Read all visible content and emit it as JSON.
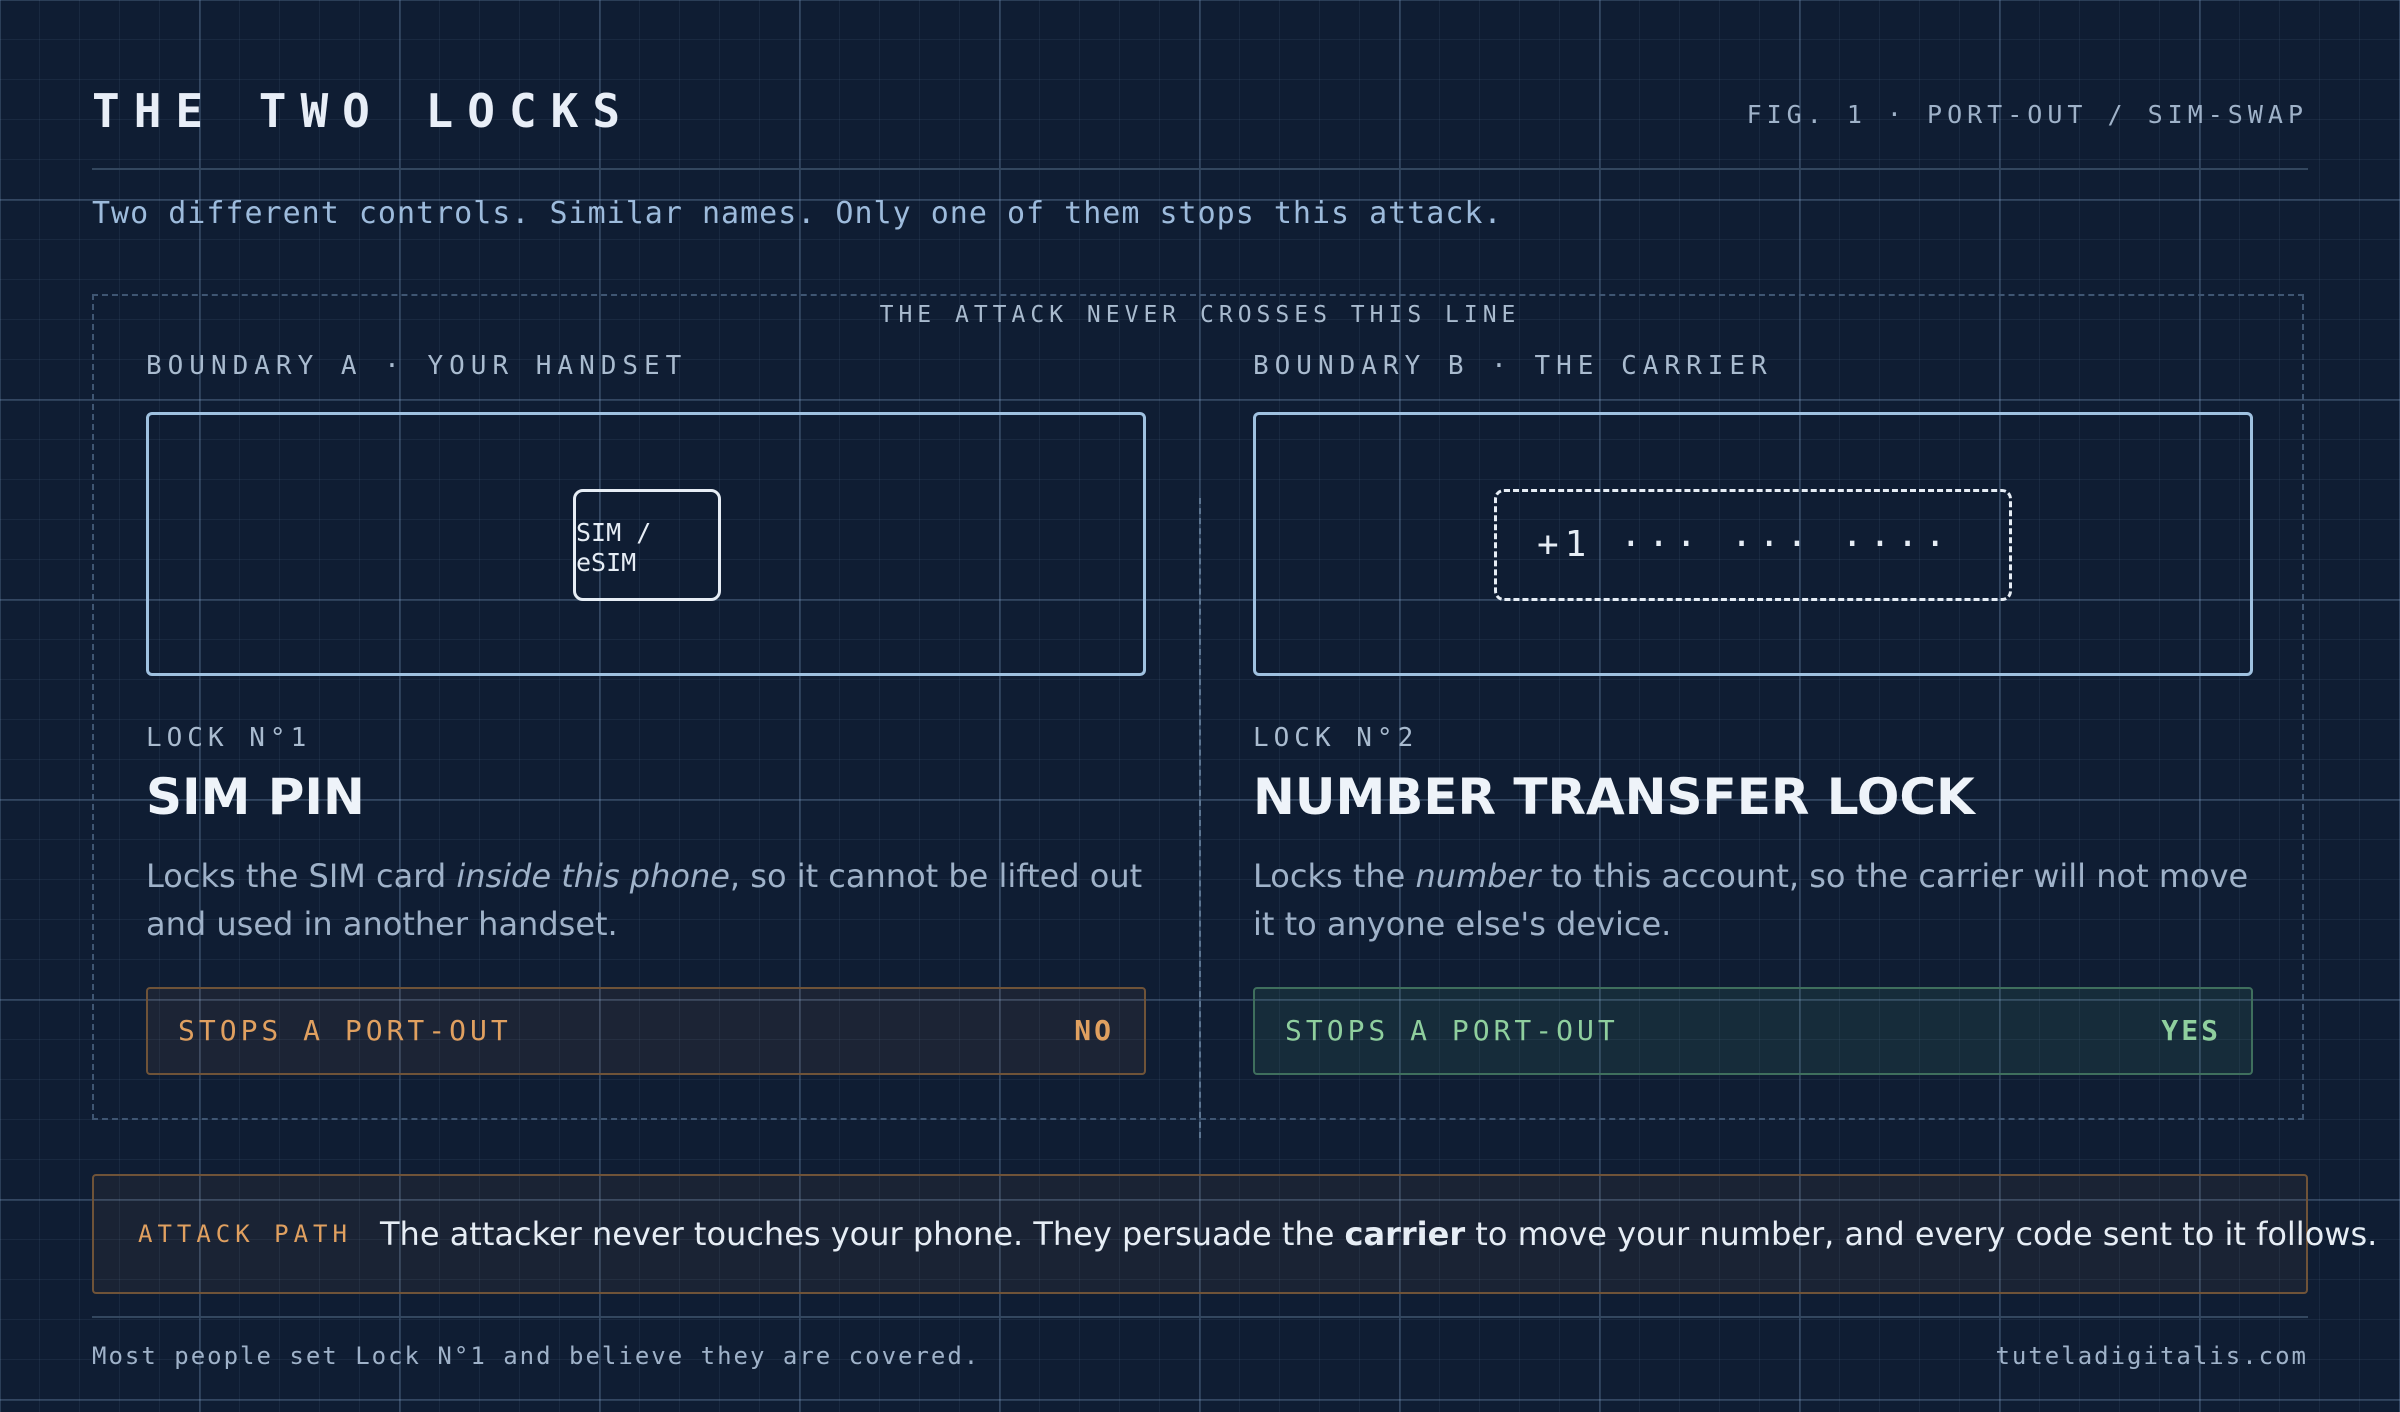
{
  "header": {
    "title": "THE TWO LOCKS",
    "fig_label": "FIG. 1 · PORT-OUT / SIM-SWAP",
    "subtitle": "Two different controls. Similar names. Only one of them stops this attack."
  },
  "divider_label": "THE ATTACK NEVER CROSSES THIS LINE",
  "left": {
    "boundary": "BOUNDARY A · YOUR HANDSET",
    "sim_line1": "SIM /",
    "sim_line2": "eSIM",
    "lock_no": "LOCK N°1",
    "lock_name": "SIM PIN",
    "desc_before": "Locks the SIM card ",
    "desc_em": "inside this phone",
    "desc_after": ", so it cannot be lifted out and used in another handset.",
    "stops_label": "STOPS A PORT-OUT",
    "stops_value": "NO"
  },
  "right": {
    "boundary": "BOUNDARY B · THE CARRIER",
    "number": "+1 ··· ··· ····",
    "lock_no": "LOCK N°2",
    "lock_name": "NUMBER TRANSFER LOCK",
    "desc_before": "Locks the ",
    "desc_em": "number",
    "desc_after": " to this account, so the carrier will not move it to anyone else's device.",
    "stops_label": "STOPS A PORT-OUT",
    "stops_value": "YES"
  },
  "attack_path": {
    "label": "ATTACK PATH",
    "text_before": "The attacker never touches your phone. They persuade the ",
    "text_bold": "carrier",
    "text_after": " to move your number, and every code sent to it follows."
  },
  "footer": {
    "note": "Most people set Lock N°1 and believe they are covered.",
    "site": "tuteladigitalis.com"
  },
  "colors": {
    "background": "#0f1d33",
    "accent_blue": "#9fc1e0",
    "warn_orange": "#e0a060",
    "ok_green": "#8fcf9e"
  }
}
